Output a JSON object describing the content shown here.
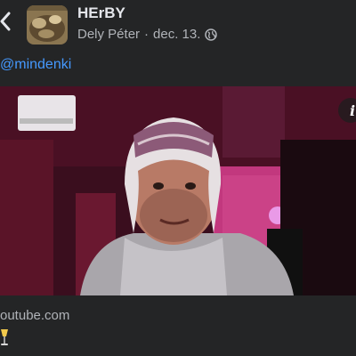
{
  "header": {
    "group_name": "HErBY",
    "author": "Dely Péter",
    "separator": "·",
    "date": "dec. 13.",
    "audience_icon": "globe-icon",
    "back_icon": "chevron-left-icon"
  },
  "post": {
    "mention": "@mindenki",
    "link_domain": "outube.com",
    "emoji_icon": "champagne-glass-icon"
  },
  "colors": {
    "background": "#242526",
    "text_primary": "#e4e6eb",
    "text_secondary": "#b0b3b8",
    "mention": "#4599ff",
    "room_light": "#b01a6a"
  }
}
